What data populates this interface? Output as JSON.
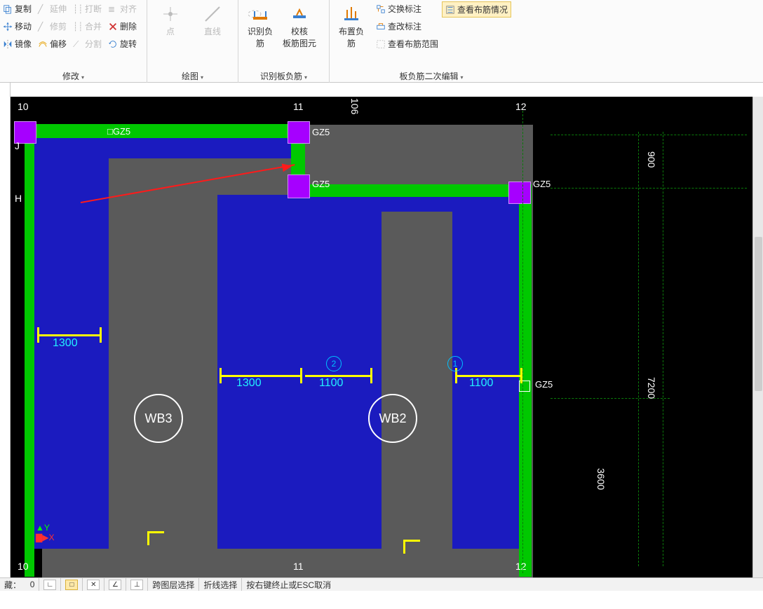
{
  "ribbon": {
    "group_modify": {
      "label": "修改",
      "copy": "复制",
      "extend": "延伸",
      "break": "打断",
      "align": "对齐",
      "move": "移动",
      "trim": "修剪",
      "merge": "合并",
      "delete": "删除",
      "mirror": "镜像",
      "offset": "偏移",
      "split": "分割",
      "rotate": "旋转"
    },
    "group_draw": {
      "label": "绘图",
      "point": "点",
      "line": "直线"
    },
    "group_identify": {
      "label": "识别板负筋",
      "btn1": "识别负筋",
      "btn2": "校核\n板筋图元"
    },
    "group_board": {
      "label": "板负筋二次编辑",
      "arrange": "布置负筋",
      "swap": "交换标注",
      "modify": "查改标注",
      "range": "查看布筋范围",
      "view": "查看布筋情况"
    }
  },
  "canvas": {
    "grid_cols": {
      "a": "10",
      "b": "11",
      "c": "12"
    },
    "grid_rows": {
      "j": "J",
      "h": "H"
    },
    "col_label": "GZ5",
    "dims_h": {
      "d900": "900",
      "d7200": "7200",
      "d3600": "3600",
      "d106": "106"
    },
    "bars": {
      "b1300": "1300",
      "b1300b": "1300",
      "b1100a": "1100",
      "b1100b": "1100"
    },
    "bubbles": {
      "wb3": "WB3",
      "wb2": "WB2"
    },
    "tags": {
      "t1": "1",
      "t2": "2"
    },
    "gz_square": "GZ5",
    "axis": {
      "x": "X",
      "y": "Y"
    }
  },
  "status": {
    "hidden": "藏：",
    "hidden_n": "0",
    "cross": "跨图层选择",
    "polyline": "折线选择",
    "hint": "按右键终止或ESC取消"
  }
}
